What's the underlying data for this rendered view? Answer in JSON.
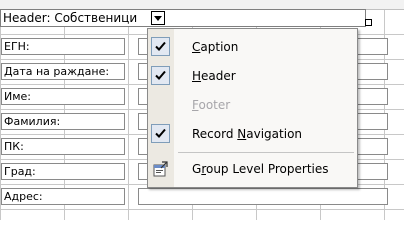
{
  "header_band": {
    "label": "Header: Собственици"
  },
  "form_fields": [
    {
      "label": "ЕГН:"
    },
    {
      "label": "Дата на раждане:"
    },
    {
      "label": "Име:"
    },
    {
      "label": "Фамилия:"
    },
    {
      "label": "ПК:"
    },
    {
      "label": "Град:"
    },
    {
      "label": "Адрес:"
    }
  ],
  "context_menu": {
    "items": [
      {
        "pre": "",
        "key": "C",
        "post": "aption",
        "checked": true,
        "disabled": false
      },
      {
        "pre": "",
        "key": "H",
        "post": "eader",
        "checked": true,
        "disabled": false
      },
      {
        "pre": "",
        "key": "F",
        "post": "ooter",
        "checked": false,
        "disabled": true
      },
      {
        "pre": "Record ",
        "key": "N",
        "post": "avigation",
        "checked": true,
        "disabled": false
      },
      {
        "pre": "G",
        "key": "r",
        "post": "oup Level Properties",
        "checked": false,
        "disabled": false,
        "icon": "properties-icon"
      }
    ]
  },
  "colors": {
    "menu_bg": "#f9f8f6",
    "check_bg": "#e2e8f2",
    "disabled_text": "#a7a6aa"
  }
}
